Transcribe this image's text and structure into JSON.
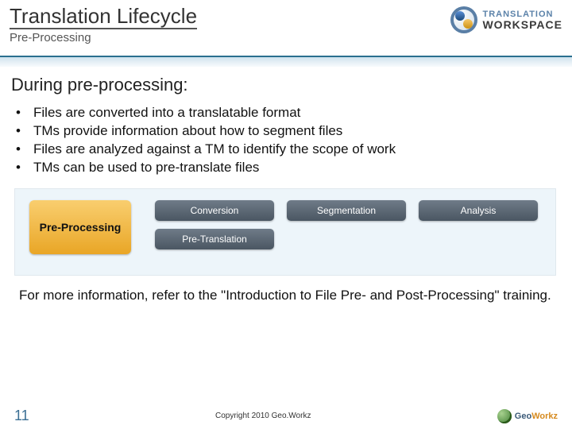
{
  "header": {
    "title": "Translation Lifecycle",
    "subtitle": "Pre-Processing",
    "logo": {
      "top": "TRANSLATION",
      "bottom": "WORKSPACE"
    }
  },
  "body": {
    "heading": "During pre-processing:",
    "bullets": [
      "Files are converted into a translatable format",
      "TMs provide information about how to segment files",
      "Files are analyzed against a TM to identify the scope of work",
      "TMs can be used to pre-translate files"
    ],
    "diagram": {
      "main": "Pre-Processing",
      "row1": [
        "Conversion",
        "Segmentation",
        "Analysis"
      ],
      "row2": [
        "Pre-Translation"
      ]
    },
    "more_info": "For more information, refer to the \"Introduction to File Pre- and Post-Processing\" training."
  },
  "footer": {
    "page_number": "11",
    "copyright": "Copyright 2010 Geo.Workz",
    "brand_geo": "Geo",
    "brand_workz": "Workz"
  }
}
